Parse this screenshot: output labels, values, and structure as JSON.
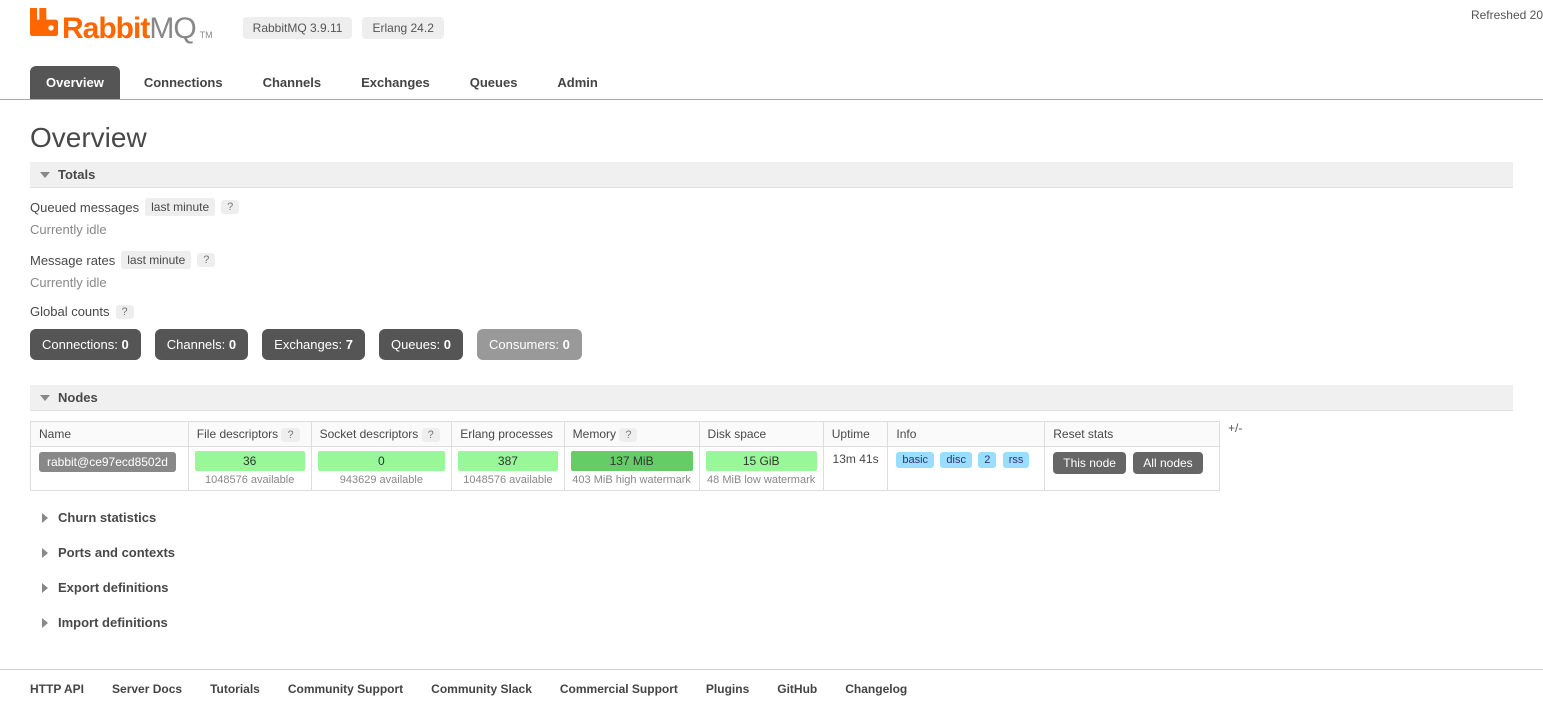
{
  "header": {
    "logo_rabbit": "Rabbit",
    "logo_mq": "MQ",
    "logo_tm": "TM",
    "version_rabbitmq": "RabbitMQ 3.9.11",
    "version_erlang": "Erlang 24.2",
    "refreshed": "Refreshed 20"
  },
  "nav": {
    "overview": "Overview",
    "connections": "Connections",
    "channels": "Channels",
    "exchanges": "Exchanges",
    "queues": "Queues",
    "admin": "Admin"
  },
  "page": {
    "title": "Overview",
    "totals_section": "Totals",
    "queued_label": "Queued messages",
    "queued_timespan": "last minute",
    "help": "?",
    "idle1": "Currently idle",
    "rates_label": "Message rates",
    "rates_timespan": "last minute",
    "idle2": "Currently idle",
    "global_counts_label": "Global counts"
  },
  "counts": {
    "connections_label": "Connections:",
    "connections_value": "0",
    "channels_label": "Channels:",
    "channels_value": "0",
    "exchanges_label": "Exchanges:",
    "exchanges_value": "7",
    "queues_label": "Queues:",
    "queues_value": "0",
    "consumers_label": "Consumers:",
    "consumers_value": "0"
  },
  "nodes": {
    "section": "Nodes",
    "plusminus": "+/-",
    "headers": {
      "name": "Name",
      "fd": "File descriptors",
      "sd": "Socket descriptors",
      "ep": "Erlang processes",
      "mem": "Memory",
      "disk": "Disk space",
      "uptime": "Uptime",
      "info": "Info",
      "reset": "Reset stats"
    },
    "row": {
      "name": "rabbit@ce97ecd8502d",
      "fd_val": "36",
      "fd_sub": "1048576 available",
      "sd_val": "0",
      "sd_sub": "943629 available",
      "ep_val": "387",
      "ep_sub": "1048576 available",
      "mem_val": "137 MiB",
      "mem_sub": "403 MiB high watermark",
      "disk_val": "15 GiB",
      "disk_sub": "48 MiB low watermark",
      "uptime": "13m 41s",
      "info_basic": "basic",
      "info_disc": "disc",
      "info_2": "2",
      "info_rss": "rss",
      "reset_this": "This node",
      "reset_all": "All nodes"
    }
  },
  "collapsed": {
    "churn": "Churn statistics",
    "ports": "Ports and contexts",
    "export": "Export definitions",
    "import": "Import definitions"
  },
  "footer": {
    "http_api": "HTTP API",
    "server_docs": "Server Docs",
    "tutorials": "Tutorials",
    "community_support": "Community Support",
    "community_slack": "Community Slack",
    "commercial_support": "Commercial Support",
    "plugins": "Plugins",
    "github": "GitHub",
    "changelog": "Changelog"
  }
}
